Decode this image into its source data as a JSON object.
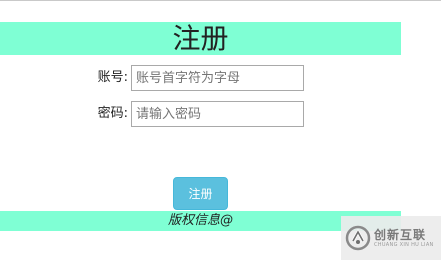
{
  "header": {
    "title": "注册"
  },
  "form": {
    "username": {
      "label": "账号:",
      "value": "",
      "placeholder": "账号首字符为字母"
    },
    "password": {
      "label": "密码:",
      "value": "",
      "placeholder": "请输入密码"
    },
    "submit_label": "注册"
  },
  "footer": {
    "text": "版权信息@"
  },
  "watermark": {
    "name": "创新互联",
    "subtitle": "CHUANG XIN HU LIAN",
    "icon": "chuangxin-logo-icon"
  },
  "colors": {
    "bar_accent": "#7fffd4",
    "button": "#5bc0de",
    "button_text": "#ffffff"
  }
}
